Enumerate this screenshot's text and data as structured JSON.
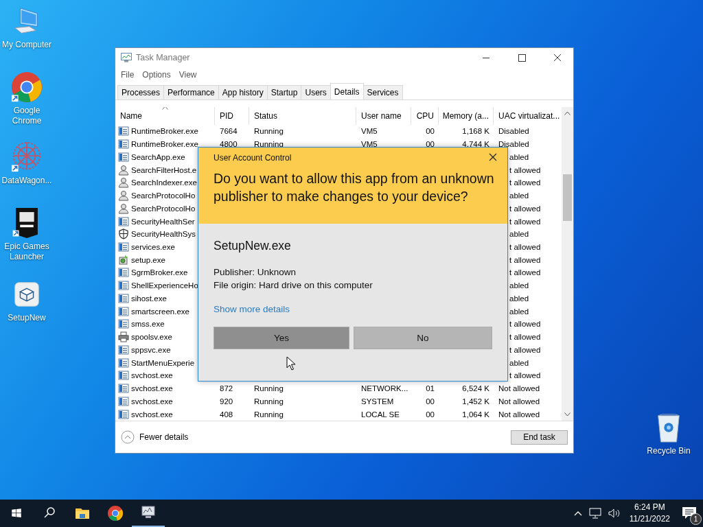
{
  "desktop_icons": [
    {
      "label": "My Computer"
    },
    {
      "label": "Google Chrome"
    },
    {
      "label": "DataWagon..."
    },
    {
      "label": "Epic Games Launcher"
    },
    {
      "label": "SetupNew"
    }
  ],
  "recycle_bin": {
    "label": "Recycle Bin"
  },
  "task_manager": {
    "title": "Task Manager",
    "menu": [
      "File",
      "Options",
      "View"
    ],
    "tabs": [
      {
        "label": "Processes",
        "selected": false
      },
      {
        "label": "Performance",
        "selected": false
      },
      {
        "label": "App history",
        "selected": false
      },
      {
        "label": "Startup",
        "selected": false
      },
      {
        "label": "Users",
        "selected": false
      },
      {
        "label": "Details",
        "selected": true
      },
      {
        "label": "Services",
        "selected": false
      }
    ],
    "columns": [
      "Name",
      "PID",
      "Status",
      "User name",
      "CPU",
      "Memory (a...",
      "UAC virtualizat..."
    ],
    "rows": [
      {
        "kind": "app",
        "name": "RuntimeBroker.exe",
        "pid": "7664",
        "status": "Running",
        "user": "VM5",
        "cpu": "00",
        "memory": "1,168 K",
        "uac": "Disabled"
      },
      {
        "kind": "app",
        "name": "RuntimeBroker.exe",
        "pid": "4800",
        "status": "Running",
        "user": "VM5",
        "cpu": "00",
        "memory": "4,744 K",
        "uac": "Disabled"
      },
      {
        "kind": "app",
        "name": "SearchApp.exe",
        "uac": "abled"
      },
      {
        "kind": "service",
        "name": "SearchFilterHost.e",
        "uac": "t allowed"
      },
      {
        "kind": "service",
        "name": "SearchIndexer.exe",
        "uac": "t allowed"
      },
      {
        "kind": "service",
        "name": "SearchProtocolHo",
        "uac": "abled"
      },
      {
        "kind": "service",
        "name": "SearchProtocolHo",
        "uac": "t allowed"
      },
      {
        "kind": "app",
        "name": "SecurityHealthSer",
        "uac": "t allowed"
      },
      {
        "kind": "shield",
        "name": "SecurityHealthSys",
        "uac": "abled"
      },
      {
        "kind": "app",
        "name": "services.exe",
        "uac": "t allowed"
      },
      {
        "kind": "setup",
        "name": "setup.exe",
        "uac": "t allowed"
      },
      {
        "kind": "app",
        "name": "SgrmBroker.exe",
        "uac": "t allowed"
      },
      {
        "kind": "app",
        "name": "ShellExperienceHo",
        "uac": "abled"
      },
      {
        "kind": "app",
        "name": "sihost.exe",
        "uac": "abled"
      },
      {
        "kind": "app",
        "name": "smartscreen.exe",
        "uac": "abled"
      },
      {
        "kind": "app",
        "name": "smss.exe",
        "uac": "t allowed"
      },
      {
        "kind": "printer",
        "name": "spoolsv.exe",
        "uac": "t allowed"
      },
      {
        "kind": "app",
        "name": "sppsvc.exe",
        "uac": "t allowed"
      },
      {
        "kind": "app",
        "name": "StartMenuExperie",
        "uac": "abled"
      },
      {
        "kind": "app",
        "name": "svchost.exe",
        "uac": "t allowed"
      },
      {
        "kind": "app",
        "name": "svchost.exe",
        "pid": "872",
        "status": "Running",
        "user": "NETWORK...",
        "cpu": "01",
        "memory": "6,524 K",
        "uac": "Not allowed"
      },
      {
        "kind": "app",
        "name": "svchost.exe",
        "pid": "920",
        "status": "Running",
        "user": "SYSTEM",
        "cpu": "00",
        "memory": "1,452 K",
        "uac": "Not allowed"
      },
      {
        "kind": "app",
        "name": "svchost.exe",
        "pid": "408",
        "status": "Running",
        "user": "LOCAL SE",
        "cpu": "00",
        "memory": "1,064 K",
        "uac": "Not allowed"
      }
    ],
    "footer": {
      "toggle": "Fewer details",
      "button": "End task"
    }
  },
  "uac_dialog": {
    "title": "User Account Control",
    "question": "Do you want to allow this app from an unknown publisher to make changes to your device?",
    "program": "SetupNew.exe",
    "details": [
      "Publisher: Unknown",
      "File origin: Hard drive on this computer"
    ],
    "link": "Show more details",
    "buttons": [
      {
        "label": "Yes",
        "hovered": true
      },
      {
        "label": "No",
        "hovered": false
      }
    ]
  },
  "taskbar": {
    "time": "6:24 PM",
    "date": "11/21/2022",
    "notifications": "1"
  }
}
